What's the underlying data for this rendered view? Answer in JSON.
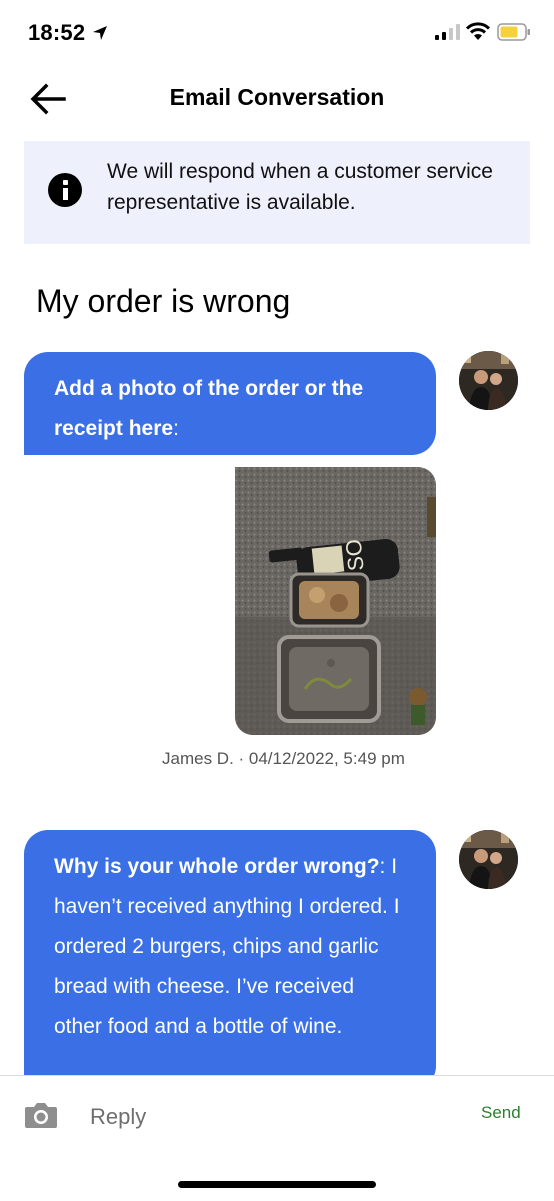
{
  "status_bar": {
    "time": "18:52"
  },
  "header": {
    "title": "Email Conversation"
  },
  "notice": {
    "text": "We will respond when a customer service representative is available."
  },
  "conversation": {
    "subject": "My order is wrong",
    "messages": [
      {
        "bold": "Add a photo of the order or the receipt here",
        "text": ":"
      },
      {
        "attachment": "photo",
        "meta": "James D. · 04/12/2022, 5:49 pm"
      },
      {
        "bold": "Why is your whole order wrong?",
        "text": ": I haven’t received anything I ordered. I ordered 2 burgers, chips and garlic bread with cheese. I’ve received other food and a bottle of wine."
      }
    ]
  },
  "reply_bar": {
    "placeholder": "Reply",
    "send_label": "Send"
  },
  "colors": {
    "bubble": "#3b6fe5",
    "notice_bg": "#eef0fb",
    "send": "#2e7d32"
  }
}
